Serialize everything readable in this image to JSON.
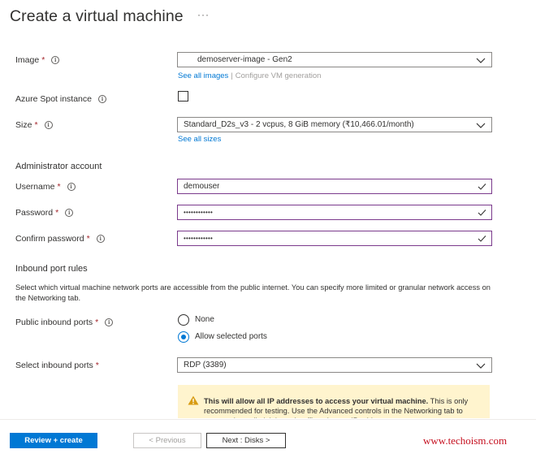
{
  "header": {
    "title": "Create a virtual machine",
    "more": "···"
  },
  "image": {
    "label": "Image",
    "required": "*",
    "value": "demoserver-image - Gen2",
    "link_all": "See all images",
    "link_sep": "|",
    "link_configure": "Configure VM generation"
  },
  "spot": {
    "label": "Azure Spot instance",
    "checked": false
  },
  "size": {
    "label": "Size",
    "required": "*",
    "value": "Standard_D2s_v3 - 2 vcpus, 8 GiB memory (₹10,466.01/month)",
    "link_all": "See all sizes"
  },
  "admin": {
    "heading": "Administrator account",
    "username_label": "Username",
    "username_value": "demouser",
    "password_label": "Password",
    "password_value": "••••••••••••",
    "confirm_label": "Confirm password",
    "confirm_value": "••••••••••••",
    "required": "*"
  },
  "inbound": {
    "heading": "Inbound port rules",
    "description": "Select which virtual machine network ports are accessible from the public internet. You can specify more limited or granular network access on the Networking tab.",
    "public_label": "Public inbound ports",
    "required": "*",
    "options": [
      "None",
      "Allow selected ports"
    ],
    "selected": "Allow selected ports",
    "select_label": "Select inbound ports",
    "select_value": "RDP (3389)"
  },
  "warning": {
    "bold": "This will allow all IP addresses to access your virtual machine.",
    "text": " This is only recommended for testing.  Use the Advanced controls in the Networking tab to create rules to limit inbound traffic to known IP addresses."
  },
  "footer": {
    "review_create": "Review + create",
    "previous": "< Previous",
    "next": "Next : Disks >"
  },
  "watermark": "www.techoism.com",
  "colors": {
    "accent": "#0078d4",
    "valid_border": "#7b3a8c",
    "required": "#a4262c",
    "warning_bg": "#fff4ce",
    "warning_icon": "#d89c13",
    "watermark": "#c50f1f"
  }
}
